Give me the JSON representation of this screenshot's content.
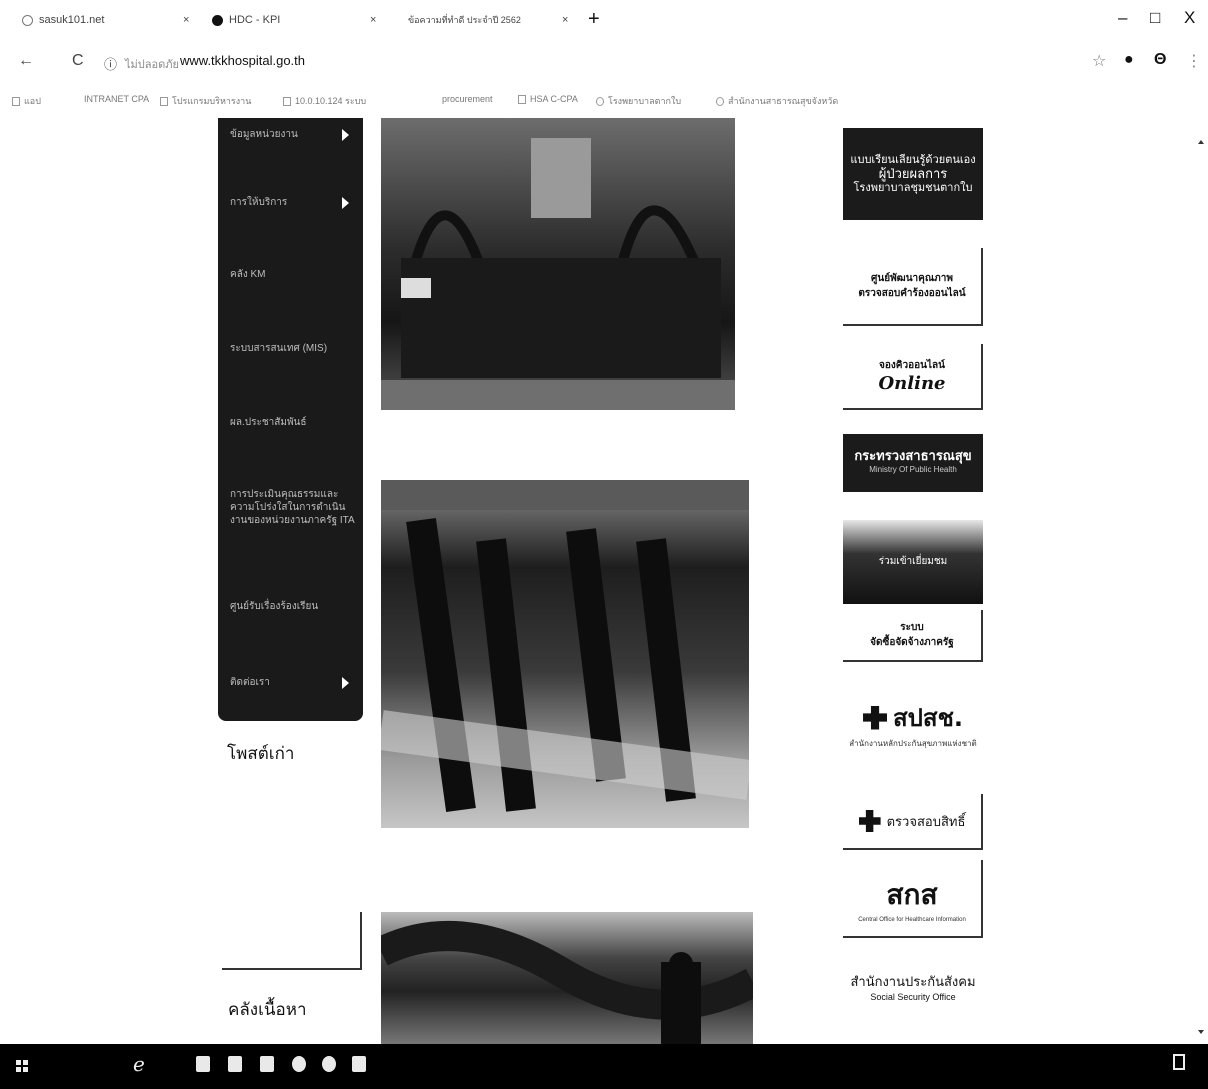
{
  "browser": {
    "tabs": [
      {
        "label": "sasuk101.net",
        "icon": "page-icon"
      },
      {
        "label": "HDC - KPI",
        "icon": "hdc-icon"
      },
      {
        "label": "ข้อความที่ทำดี ประจำปี 2562",
        "icon": "page-icon"
      }
    ],
    "new_tab": "+",
    "window_controls": {
      "minimize": "–",
      "maximize": "□",
      "close": "X"
    },
    "nav": {
      "back": "←",
      "reload": "C",
      "info": "ⓘ"
    },
    "address": {
      "security_label": "ไม่ปลอดภัย",
      "url": "www.tkkhospital.go.th"
    },
    "toolbar": {
      "star": "☆",
      "ext": "●",
      "profile": "Θ",
      "menu": "⋮"
    },
    "bookmarks": [
      {
        "label": "แอป"
      },
      {
        "label": "INTRANET CPA"
      },
      {
        "label": "โปรแกรมบริหารงาน"
      },
      {
        "label": "10.0.10.124 ระบบ"
      },
      {
        "label": "procurement"
      },
      {
        "label": "HSA C-CPA"
      },
      {
        "label": "โรงพยาบาลตากใบ"
      },
      {
        "label": "สำนักงานสาธารณสุขจังหวัด"
      }
    ]
  },
  "sidebar": {
    "menu_items": [
      {
        "label": "ข้อมูลหน่วยงาน",
        "has_arrow": true
      },
      {
        "label": "การให้บริการ",
        "has_arrow": true
      },
      {
        "label": "คลัง KM",
        "has_arrow": false
      },
      {
        "label": "ระบบสารสนเทศ (MIS)",
        "has_arrow": false
      },
      {
        "label": "ผล.ประชาสัมพันธ์",
        "has_arrow": false
      },
      {
        "label": "การประเมินคุณธรรมและความโปร่งใสในการดำเนินงานของหน่วยงานภาครัฐ ITA",
        "has_arrow": false
      },
      {
        "label": "ศูนย์รับเรื่องร้องเรียน",
        "has_arrow": false
      },
      {
        "label": "ติดต่อเรา",
        "has_arrow": true
      }
    ],
    "old_posts_title": "โพสต์เก่า",
    "archive_title": "คลังเนื้อหา"
  },
  "banners": [
    {
      "line1": "แบบเรียนเลียนรู้ด้วยตนเอง",
      "line2": "ผู้ป่วยผลการ",
      "line3": "โรงพยาบาลชุมชนตากใบ"
    },
    {
      "line1": "ศูนย์พัฒนาคุณภาพ",
      "line2": "ตรวจสอบคำร้องออนไลน์"
    },
    {
      "line1": "จองคิวออนไลน์",
      "line2": "Online"
    },
    {
      "line1": "กระทรวงสาธารณสุข",
      "line2": "Ministry Of Public Health"
    },
    {
      "line1": "ร่วมเข้าเยี่ยมชม"
    },
    {
      "line1": "ระบบ",
      "line2": "จัดซื้อจัดจ้างภาครัฐ"
    },
    {
      "line1": "สปสช.",
      "line2": "สำนักงานหลักประกันสุขภาพแห่งชาติ"
    },
    {
      "line1": "ตรวจสอบสิทธิ์"
    },
    {
      "line1": "สกส",
      "line2": "Central Office for Healthcare Information"
    },
    {
      "line1": "สำนักงานประกันสังคม",
      "line2": "Social Security Office"
    }
  ],
  "taskbar": {
    "edge_glyph": "e"
  }
}
